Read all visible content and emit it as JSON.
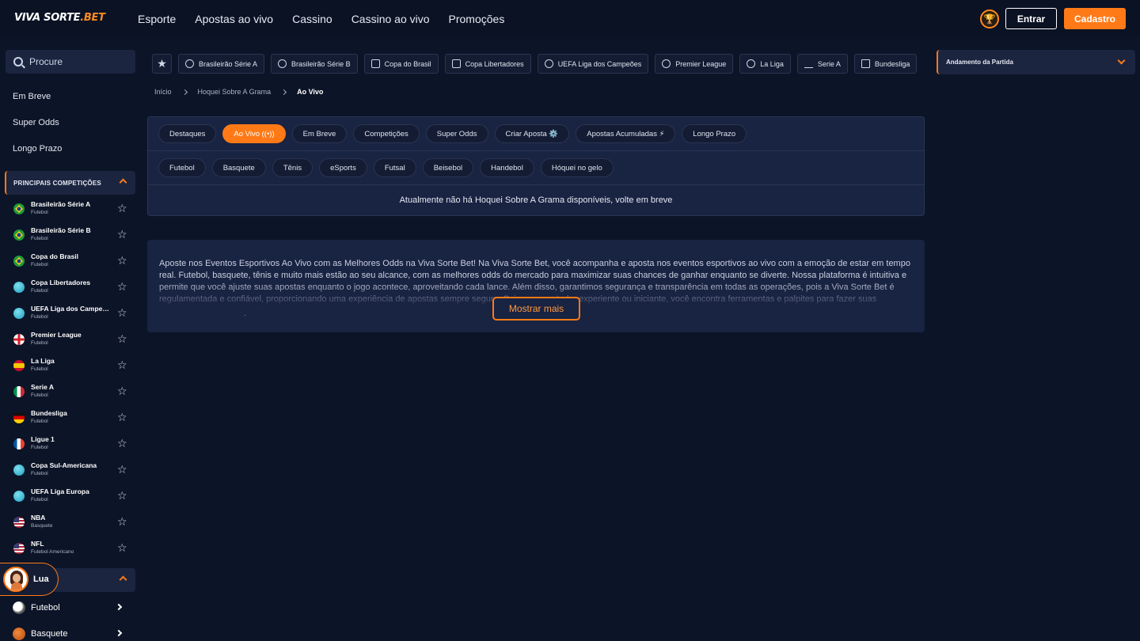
{
  "brand": {
    "logo_main": "VIVA SORTE",
    "logo_accent": ".BET",
    "accent_color": "#ff7a17"
  },
  "topnav": [
    "Esporte",
    "Apostas ao vivo",
    "Cassino",
    "Cassino ao vivo",
    "Promoções"
  ],
  "header_actions": {
    "login": "Entrar",
    "register": "Cadastro",
    "trophy_icon": "trophy-icon"
  },
  "search": {
    "placeholder": "Procure"
  },
  "quick_links": [
    "Em Breve",
    "Super Odds",
    "Longo Prazo"
  ],
  "competitions_header": "PRINCIPAIS COMPETIÇÕES",
  "competitions": [
    {
      "name": "Brasileirão Série A",
      "sport": "Futebol"
    },
    {
      "name": "Brasileirão Série B",
      "sport": "Futebol"
    },
    {
      "name": "Copa do Brasil",
      "sport": "Futebol"
    },
    {
      "name": "Copa Libertadores",
      "sport": "Futebol"
    },
    {
      "name": "UEFA Liga dos Campeões",
      "sport": "Futebol"
    },
    {
      "name": "Premier League",
      "sport": "Futebol"
    },
    {
      "name": "La Liga",
      "sport": "Futebol"
    },
    {
      "name": "Serie A",
      "sport": "Futebol"
    },
    {
      "name": "Bundesliga",
      "sport": "Futebol"
    },
    {
      "name": "Ligue 1",
      "sport": "Futebol"
    },
    {
      "name": "Copa Sul-Americana",
      "sport": "Futebol"
    },
    {
      "name": "UEFA Liga Europa",
      "sport": "Futebol"
    },
    {
      "name": "NBA",
      "sport": "Basquete"
    },
    {
      "name": "NFL",
      "sport": "Futebol Americano"
    }
  ],
  "assistant": {
    "name": "Lua"
  },
  "sports": [
    "Futebol",
    "Basquete"
  ],
  "chips": [
    "Brasileirão Série A",
    "Brasileirão Série B",
    "Copa do Brasil",
    "Copa Libertadores",
    "UEFA Liga dos Campeões",
    "Premier League",
    "La Liga",
    "Serie A",
    "Bundesliga"
  ],
  "match_panel": {
    "title": "Andamento da Partida"
  },
  "breadcrumb": {
    "home": "Início",
    "section": "Hoquei Sobre A Grama",
    "current": "Ao Vivo"
  },
  "tabs": [
    "Destaques",
    "Ao Vivo ((•))",
    "Em Breve",
    "Competições",
    "Super Odds",
    "Criar Aposta ⚙️",
    "Apostas Acumuladas ⚡",
    "Longo Prazo"
  ],
  "active_tab": "Ao Vivo ((•))",
  "sport_filters": [
    "Futebol",
    "Basquete",
    "Tênis",
    "eSports",
    "Futsal",
    "Beisebol",
    "Handebol",
    "Hóquei no gelo"
  ],
  "empty_message": "Atualmente não há Hoquei Sobre A Grama disponíveis, volte em breve",
  "seo": {
    "text": "Aposte nos Eventos Esportivos Ao Vivo com as Melhores Odds na Viva Sorte Bet! Na Viva Sorte Bet, você acompanha e aposta nos eventos esportivos ao vivo com a emoção de estar em tempo real. Futebol, basquete, tênis e muito mais estão ao seu alcance, com as melhores odds do mercado para maximizar suas chances de ganhar enquanto se diverte. Nossa plataforma é intuitiva e permite que você ajuste suas apostas enquanto o jogo acontece, aproveitando cada lance. Além disso, garantimos segurança e transparência em todas as operações, pois a Viva Sorte Bet é regulamentada e confiável, proporcionando uma experiência de apostas sempre segura. Seja um apostador experiente ou iniciante, você encontra ferramentas e palpites para fazer suas escolhas com confiança. E, como",
    "more_label": "Mostrar mais"
  }
}
